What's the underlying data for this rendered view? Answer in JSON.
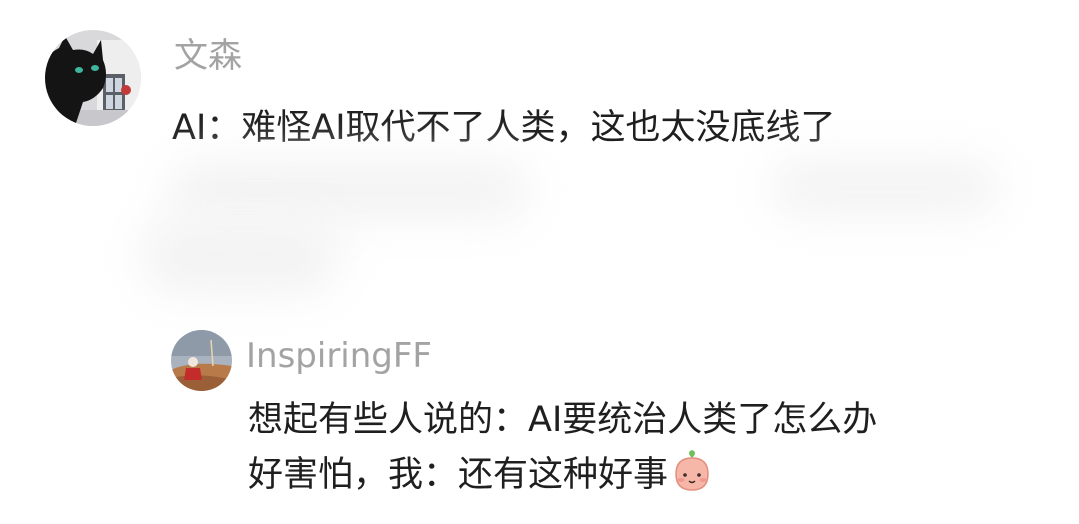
{
  "comment": {
    "author": "文森",
    "text": "AI：难怪AI取代不了人类，这也太没底线了",
    "avatar_icon": "black-cat-avatar"
  },
  "reply": {
    "author": "InspiringFF",
    "line1": "想起有些人说的：AI要统治人类了怎么办",
    "line2": "好害怕，我：还有这种好事",
    "emoji_icon": "peach-face-emoji",
    "avatar_icon": "landscape-girl-avatar"
  },
  "colors": {
    "author": "#a3a3a3",
    "text": "#1f1f1f",
    "background": "#ffffff"
  }
}
